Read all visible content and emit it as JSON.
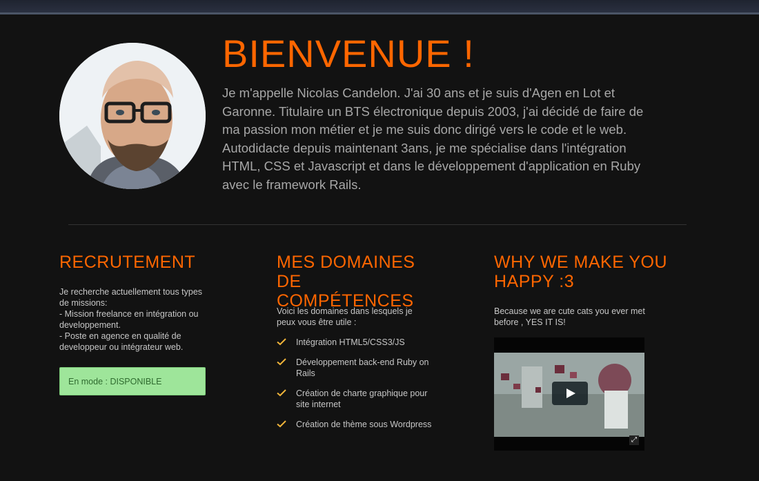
{
  "header": {
    "title": "BIENVENUE !",
    "intro": "Je m'appelle Nicolas Candelon. J'ai 30 ans et je suis d'Agen en Lot et Garonne. Titulaire un BTS électronique depuis 2003, j'ai décidé de faire de ma passion mon métier et je me suis donc dirigé vers le code et le web. Autodidacte depuis maintenant 3ans, je me spécialise dans l'intégration HTML, CSS et Javascript et dans le développement d'application en Ruby avec le framework Rails."
  },
  "recrutement": {
    "title": "RECRUTEMENT",
    "text": "Je recherche actuellement tous types de missions:\n- Mission freelance en intégration ou developpement.\n- Poste en agence en qualité de developpeur ou intégrateur web.",
    "status": "En mode : DISPONIBLE"
  },
  "domaines": {
    "title": "MES DOMAINES DE COMPÉTENCES",
    "intro": "Voici les domaines dans lesquels je peux vous être utile :",
    "items": [
      "Intégration HTML5/CSS3/JS",
      "Développement back-end Ruby on Rails",
      "Création de charte graphique pour site internet",
      "Création de thème sous Wordpress"
    ]
  },
  "happy": {
    "title": "WHY WE MAKE YOU HAPPY :3",
    "text": "Because we are cute cats you ever met before , YES IT IS!"
  },
  "colors": {
    "accent": "#ff6600",
    "background": "#121212",
    "status_bg": "#9ee59a"
  },
  "icons": [
    "check-icon",
    "play-icon",
    "fullscreen-icon"
  ]
}
